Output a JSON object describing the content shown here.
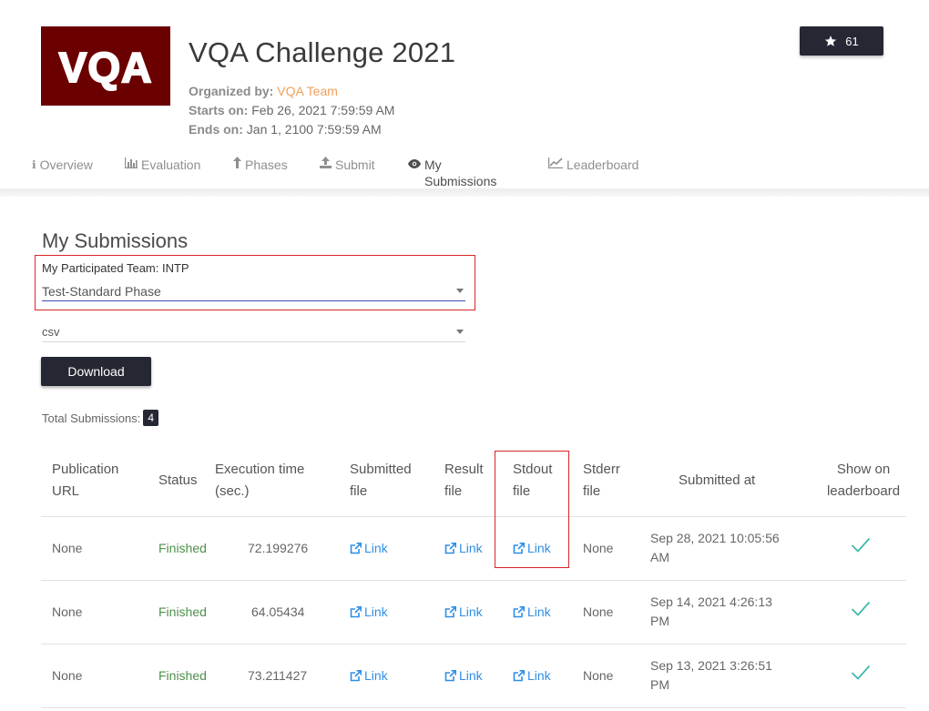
{
  "header": {
    "logo_text": "VQA",
    "title": "VQA Challenge 2021",
    "organized_label": "Organized by:",
    "organizer": "VQA Team",
    "starts_label": "Starts on:",
    "starts_value": "Feb 26, 2021 7:59:59 AM",
    "ends_label": "Ends on:",
    "ends_value": "Jan 1, 2100 7:59:59 AM",
    "star_count": "61",
    "star_icon": "star-icon"
  },
  "tabs": [
    {
      "label": "Overview",
      "icon": "info-icon",
      "active": false
    },
    {
      "label": "Evaluation",
      "icon": "bar-chart-icon",
      "active": false
    },
    {
      "label": "Phases",
      "icon": "upload-arrow-icon",
      "active": false
    },
    {
      "label": "Submit",
      "icon": "upload-icon",
      "active": false
    },
    {
      "label": "My Submissions",
      "icon": "eye-icon",
      "active": true
    },
    {
      "label": "Leaderboard",
      "icon": "line-chart-icon",
      "active": false
    }
  ],
  "main": {
    "section_title": "My Submissions",
    "team_label": "My Participated Team: INTP",
    "phase_select_value": "Test-Standard Phase",
    "format_select_value": "csv",
    "download_label": "Download",
    "total_label": "Total Submissions:",
    "total_count": "4"
  },
  "table": {
    "headers": {
      "publication": [
        "Publication",
        "URL"
      ],
      "status": "Status",
      "exec": [
        "Execution time",
        "(sec.)"
      ],
      "submitted": [
        "Submitted",
        "file"
      ],
      "result": [
        "Result",
        "file"
      ],
      "stdout": [
        "Stdout",
        "file"
      ],
      "stderr": [
        "Stderr",
        "file"
      ],
      "submitted_at": "Submitted at",
      "show": [
        "Show on",
        "leaderboard"
      ]
    },
    "rows": [
      {
        "publication": "None",
        "status": "Finished",
        "exec": "72.199276",
        "submitted": "Link",
        "result": "Link",
        "stdout": "Link",
        "stderr": "None",
        "date1": "Sep 28, 2021 10:05:56",
        "date2": "AM",
        "show": true
      },
      {
        "publication": "None",
        "status": "Finished",
        "exec": "64.05434",
        "submitted": "Link",
        "result": "Link",
        "stdout": "Link",
        "stderr": "None",
        "date1": "Sep 14, 2021 4:26:13",
        "date2": "PM",
        "show": true
      },
      {
        "publication": "None",
        "status": "Finished",
        "exec": "73.211427",
        "submitted": "Link",
        "result": "Link",
        "stdout": "Link",
        "stderr": "None",
        "date1": "Sep 13, 2021 3:26:51",
        "date2": "PM",
        "show": true
      }
    ]
  },
  "colors": {
    "accent_orange": "#f0a15a",
    "dark_button": "#252833",
    "link_blue": "#2f8ee5",
    "status_green": "#4e8f4a",
    "check_teal": "#3fb8ad",
    "highlight_red": "#d9252a",
    "logo_bg": "#6b0000"
  }
}
